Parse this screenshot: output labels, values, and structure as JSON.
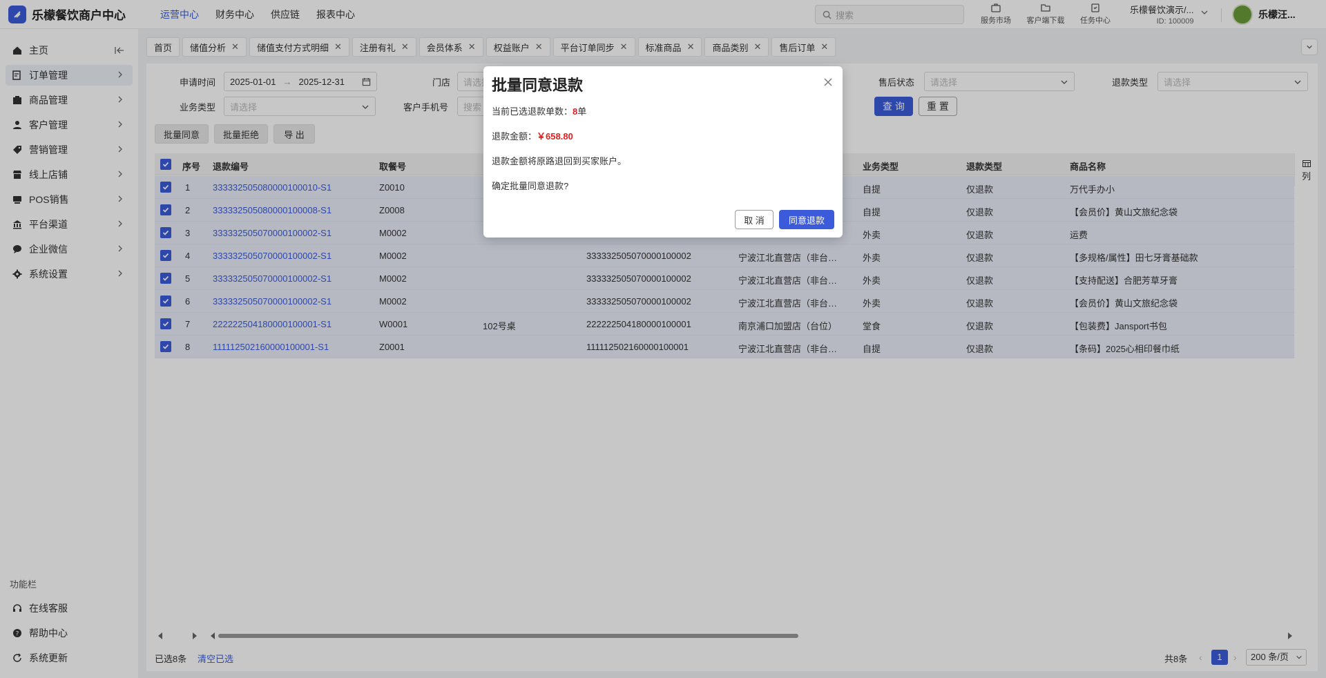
{
  "header": {
    "logo_text": "乐檬餐饮商户中心",
    "nav": [
      "运营中心",
      "财务中心",
      "供应链",
      "报表中心"
    ],
    "search_placeholder": "搜索",
    "tools": [
      "服务市场",
      "客户端下载",
      "任务中心"
    ],
    "tenant_name": "乐檬餐饮演示/...",
    "tenant_id": "ID: 100009",
    "user_name": "乐檬汪..."
  },
  "sidebar": {
    "items": [
      {
        "label": "主页",
        "icon": "home-icon"
      },
      {
        "label": "订单管理",
        "icon": "order-icon"
      },
      {
        "label": "商品管理",
        "icon": "goods-icon"
      },
      {
        "label": "客户管理",
        "icon": "user-icon"
      },
      {
        "label": "营销管理",
        "icon": "tag-icon"
      },
      {
        "label": "线上店铺",
        "icon": "store-icon"
      },
      {
        "label": "POS销售",
        "icon": "pos-icon"
      },
      {
        "label": "平台渠道",
        "icon": "bank-icon"
      },
      {
        "label": "企业微信",
        "icon": "chat-icon"
      },
      {
        "label": "系统设置",
        "icon": "gear-icon"
      }
    ],
    "group_label": "功能栏",
    "bottom_items": [
      "在线客服",
      "帮助中心",
      "系统更新"
    ]
  },
  "tabs": [
    {
      "label": "首页",
      "closable": false
    },
    {
      "label": "储值分析",
      "closable": true
    },
    {
      "label": "储值支付方式明细",
      "closable": true
    },
    {
      "label": "注册有礼",
      "closable": true
    },
    {
      "label": "会员体系",
      "closable": true
    },
    {
      "label": "权益账户",
      "closable": true
    },
    {
      "label": "平台订单同步",
      "closable": true
    },
    {
      "label": "标准商品",
      "closable": true
    },
    {
      "label": "商品类别",
      "closable": true
    },
    {
      "label": "售后订单",
      "closable": true
    }
  ],
  "filters": {
    "apply_time_label": "申请时间",
    "date_start": "2025-01-01",
    "date_end": "2025-12-31",
    "store_label": "门店",
    "store_placeholder": "请选择",
    "aftersale_status_label": "售后状态",
    "aftersale_status_placeholder": "请选择",
    "refund_type_label": "退款类型",
    "refund_type_placeholder": "请选择",
    "biz_type_label": "业务类型",
    "biz_type_placeholder": "请选择",
    "phone_label": "客户手机号",
    "phone_placeholder": "搜索",
    "query_button": "查 询",
    "reset_button": "重 置"
  },
  "actions": {
    "batch_agree": "批量同意",
    "batch_reject": "批量拒绝",
    "export": "导 出"
  },
  "table": {
    "columns": {
      "index": "序号",
      "refund_no": "退款编号",
      "pickup_no": "取餐号",
      "biz_type": "业务类型",
      "refund_type": "退款类型",
      "product": "商品名称"
    },
    "column_toggle": "列",
    "rows": [
      {
        "index": "1",
        "refund_no": "333332505080000100010-S1",
        "pickup_no": "Z0010",
        "table_no": "",
        "order_no": "",
        "store": "",
        "biz_type": "自提",
        "refund_type": "仅退款",
        "product": "万代手办小"
      },
      {
        "index": "2",
        "refund_no": "333332505080000100008-S1",
        "pickup_no": "Z0008",
        "table_no": "",
        "order_no": "",
        "store": "",
        "biz_type": "自提",
        "refund_type": "仅退款",
        "product": "【会员价】黄山文旅纪念袋"
      },
      {
        "index": "3",
        "refund_no": "333332505070000100002-S1",
        "pickup_no": "M0002",
        "table_no": "",
        "order_no": "",
        "store": "",
        "biz_type": "外卖",
        "refund_type": "仅退款",
        "product": "运费"
      },
      {
        "index": "4",
        "refund_no": "333332505070000100002-S1",
        "pickup_no": "M0002",
        "table_no": "",
        "order_no": "333332505070000100002",
        "store": "宁波江北直营店（非台…",
        "biz_type": "外卖",
        "refund_type": "仅退款",
        "product": "【多规格/属性】田七牙膏基础款"
      },
      {
        "index": "5",
        "refund_no": "333332505070000100002-S1",
        "pickup_no": "M0002",
        "table_no": "",
        "order_no": "333332505070000100002",
        "store": "宁波江北直营店（非台…",
        "biz_type": "外卖",
        "refund_type": "仅退款",
        "product": "【支持配送】合肥芳草牙膏"
      },
      {
        "index": "6",
        "refund_no": "333332505070000100002-S1",
        "pickup_no": "M0002",
        "table_no": "",
        "order_no": "333332505070000100002",
        "store": "宁波江北直营店（非台…",
        "biz_type": "外卖",
        "refund_type": "仅退款",
        "product": "【会员价】黄山文旅纪念袋"
      },
      {
        "index": "7",
        "refund_no": "222222504180000100001-S1",
        "pickup_no": "W0001",
        "table_no": "102号桌",
        "order_no": "222222504180000100001",
        "store": "南京浦口加盟店（台位）",
        "biz_type": "堂食",
        "refund_type": "仅退款",
        "product": "【包装费】Jansport书包"
      },
      {
        "index": "8",
        "refund_no": "111112502160000100001-S1",
        "pickup_no": "Z0001",
        "table_no": "",
        "order_no": "111112502160000100001",
        "store": "宁波江北直营店（非台…",
        "biz_type": "自提",
        "refund_type": "仅退款",
        "product": "【条码】2025心相印餐巾纸"
      }
    ]
  },
  "footer": {
    "selected_text": "已选8条",
    "clear_selection": "清空已选",
    "total": "共8条",
    "page": "1",
    "page_size": "200 条/页"
  },
  "dialog": {
    "title": "批量同意退款",
    "count_prefix": "当前已选退款单数：",
    "count_value": "8",
    "count_suffix": "单",
    "amount_prefix": "退款金额：",
    "amount_value": "￥658.80",
    "note": "退款金额将原路退回到买家账户。",
    "confirm_text": "确定批量同意退款?",
    "cancel_button": "取 消",
    "ok_button": "同意退款"
  },
  "colors": {
    "primary": "#3b5bdb",
    "danger": "#e02020",
    "row_selected": "#e9eef9"
  }
}
